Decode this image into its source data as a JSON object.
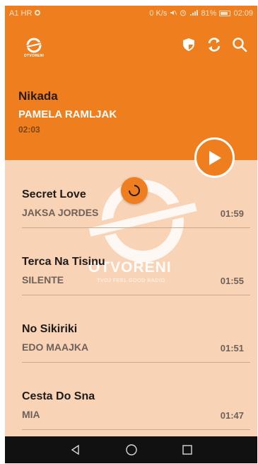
{
  "status_bar": {
    "carrier": "A1 HR",
    "speed": "0 K/s",
    "battery": "81%",
    "time": "02:09"
  },
  "header": {
    "logo_text": "OTVORENI",
    "icons": [
      "shield-icon",
      "refresh-icon",
      "search-icon"
    ]
  },
  "now_playing": {
    "song": "Nikada",
    "artist": "PAMELA RAMLJAK",
    "time": "02:03"
  },
  "watermark": {
    "name": "OTVORENI",
    "tagline": "TVOJ FEEL GOOD RADIO"
  },
  "playlist": [
    {
      "title": "Secret Love",
      "artist": "JAKSA JORDES",
      "duration": "01:59"
    },
    {
      "title": "Terca Na Tisinu",
      "artist": "SILENTE",
      "duration": "01:55"
    },
    {
      "title": "No Sikiriki",
      "artist": "EDO MAAJKA",
      "duration": "01:51"
    },
    {
      "title": "Cesta Do Sna",
      "artist": "MIA",
      "duration": "01:47"
    }
  ],
  "colors": {
    "accent": "#ef7f1e",
    "list_bg": "#f9d3b6",
    "nav_bg": "#111111"
  }
}
